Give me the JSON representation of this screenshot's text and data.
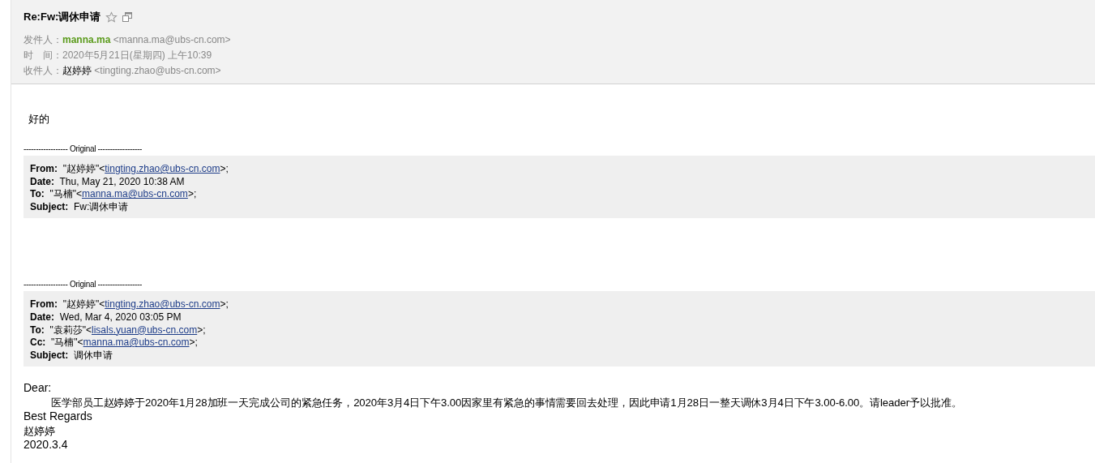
{
  "header": {
    "title": "Re:Fw:调休申请",
    "starred": false,
    "rows": [
      {
        "kind": "sender",
        "label": "发件人：",
        "name": "manna.ma",
        "address": "<manna.ma@ubs-cn.com>"
      },
      {
        "kind": "plain",
        "label": "时　间：",
        "value": "2020年5月21日(星期四) 上午10:39"
      },
      {
        "kind": "contact",
        "label": "收件人：",
        "name": "赵婷婷",
        "address": "<tingting.zhao@ubs-cn.com>"
      }
    ]
  },
  "reply": "好的",
  "quotes": [
    {
      "separator": "------------------ Original ------------------",
      "fields": [
        {
          "label": "From:",
          "prefix": "\"赵婷婷\"<",
          "link": "tingting.zhao@ubs-cn.com",
          "suffix": ">;"
        },
        {
          "label": "Date:",
          "prefix": "Thu, May 21, 2020 10:38 AM"
        },
        {
          "label": "To:",
          "prefix": "\"马楠\"<",
          "link": "manna.ma@ubs-cn.com",
          "suffix": ">;"
        },
        {
          "label": "Subject:",
          "prefix": "Fw:调休申请"
        }
      ]
    },
    {
      "separator": "------------------ Original ------------------",
      "fields": [
        {
          "label": "From:",
          "prefix": "\"赵婷婷\"<",
          "link": "tingting.zhao@ubs-cn.com",
          "suffix": ">;"
        },
        {
          "label": "Date:",
          "prefix": "Wed, Mar 4, 2020 03:05 PM"
        },
        {
          "label": "To:",
          "prefix": "\"袁莉莎\"<",
          "link": "lisals.yuan@ubs-cn.com",
          "suffix": ">;"
        },
        {
          "label": "Cc:",
          "prefix": "\"马楠\"<",
          "link": "manna.ma@ubs-cn.com",
          "suffix": ">;"
        },
        {
          "label": "Subject:",
          "prefix": "调休申请"
        }
      ]
    }
  ],
  "message": {
    "greeting": "Dear:",
    "paragraph": "医学部员工赵婷婷于2020年1月28加班一天完成公司的紧急任务，2020年3月4日下午3.00因家里有紧急的事情需要回去处理，因此申请1月28日一整天调休3月4日下午3.00-6.00。请leader予以批准。",
    "closing": "Best Regards",
    "signature": "赵婷婷",
    "date": "2020.3.4"
  }
}
